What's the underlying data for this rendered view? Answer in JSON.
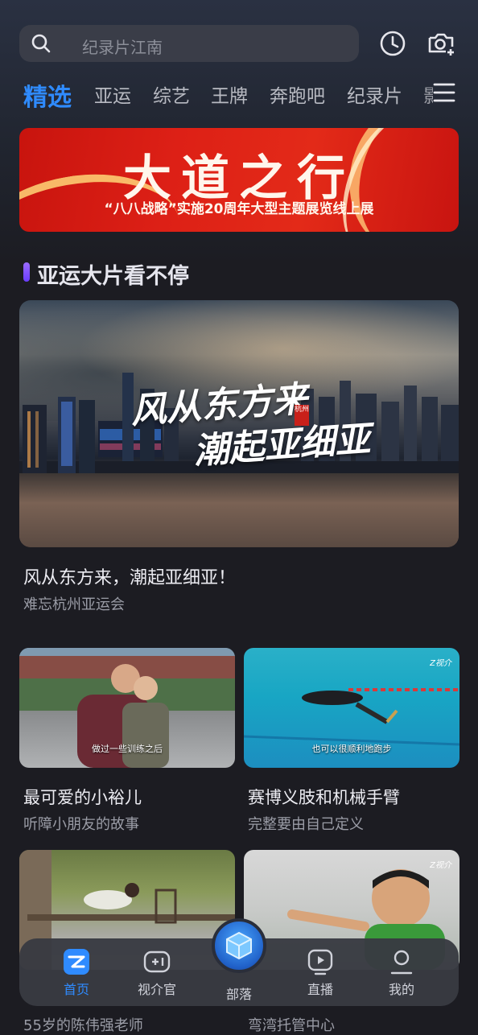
{
  "search": {
    "placeholder": "纪录片江南"
  },
  "header": {
    "history_icon": "clock-icon",
    "camera_icon": "camera-plus-icon"
  },
  "tabs": [
    {
      "label": "精选",
      "active": true
    },
    {
      "label": "亚运"
    },
    {
      "label": "综艺"
    },
    {
      "label": "王牌"
    },
    {
      "label": "奔跑吧"
    },
    {
      "label": "纪录片"
    }
  ],
  "banner": {
    "title": "大道之行",
    "subtitle": "“八八战略”实施20周年大型主题展览线上展"
  },
  "section": {
    "title": "亚运大片看不停"
  },
  "hero": {
    "overlay_line1": "风从东方来",
    "overlay_line2": "潮起亚细亚",
    "seal": "杭州",
    "title": "风从东方来，潮起亚细亚！",
    "subtitle": "难忘杭州亚运会"
  },
  "cards": [
    {
      "title": "最可爱的小裕儿",
      "subtitle": "听障小朋友的故事",
      "caption": "做过一些训练之后"
    },
    {
      "title": "赛博义肢和机械手臂",
      "subtitle": "完整要由自己定义",
      "caption": "也可以很顺利地跑步"
    },
    {
      "title": "",
      "subtitle": "55岁的陈伟强老师"
    },
    {
      "title": "",
      "subtitle": "弯湾托管中心"
    }
  ],
  "nav": [
    {
      "label": "首页",
      "icon": "home-logo-icon",
      "active": true
    },
    {
      "label": "视介官",
      "icon": "video-plus-icon"
    },
    {
      "label": "部落",
      "icon": "cube-icon"
    },
    {
      "label": "直播",
      "icon": "play-tv-icon"
    },
    {
      "label": "我的",
      "icon": "person-icon"
    }
  ],
  "colors": {
    "accent": "#2f8bff",
    "background": "#1c1c22",
    "banner": "#dd2016"
  }
}
